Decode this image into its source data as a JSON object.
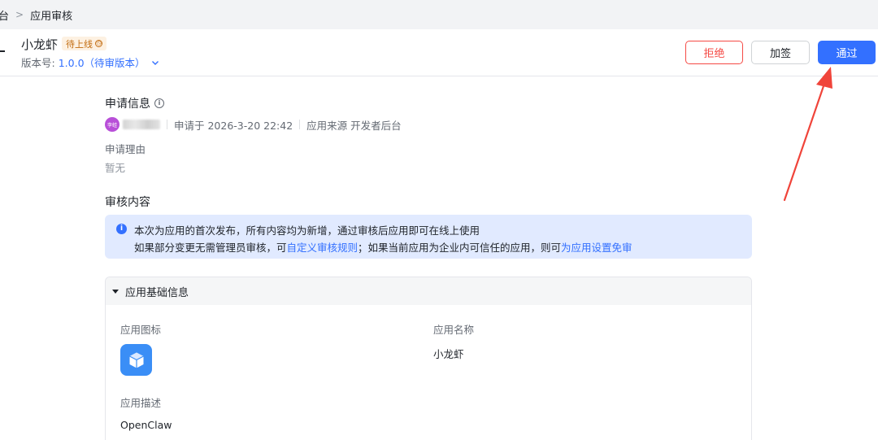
{
  "breadcrumb": {
    "prev": "台",
    "current": "应用审核"
  },
  "header": {
    "app_name": "小龙虾",
    "status": "待上线",
    "version_label": "版本号:",
    "version_value": "1.0.0（待审版本）"
  },
  "actions": {
    "reject": "拒绝",
    "add_sign": "加签",
    "pass": "通过"
  },
  "apply_info": {
    "title": "申请信息",
    "avatar_text": "李蛙",
    "applied_at": "申请于 2026-3-20 22:42",
    "source": "应用来源 开发者后台",
    "reason_label": "申请理由",
    "reason_value": "暂无"
  },
  "review": {
    "title": "审核内容",
    "notice_line1": "本次为应用的首次发布，所有内容均为新增，通过审核后应用即可在线上使用",
    "notice_line2_pre": "如果部分变更无需管理员审核，可",
    "notice_link1": "自定义审核规则",
    "notice_line2_mid": "；如果当前应用为企业内可信任的应用，则可",
    "notice_link2": "为应用设置免审"
  },
  "basic_info": {
    "title": "应用基础信息",
    "icon_label": "应用图标",
    "name_label": "应用名称",
    "name_value": "小龙虾",
    "desc_label": "应用描述",
    "desc_value": "OpenClaw"
  },
  "colors": {
    "primary": "#3370ff",
    "danger": "#f54a45",
    "warning_bg": "#fdf1e2",
    "notice_bg": "#e1eaff",
    "arrow": "#f0443a"
  }
}
